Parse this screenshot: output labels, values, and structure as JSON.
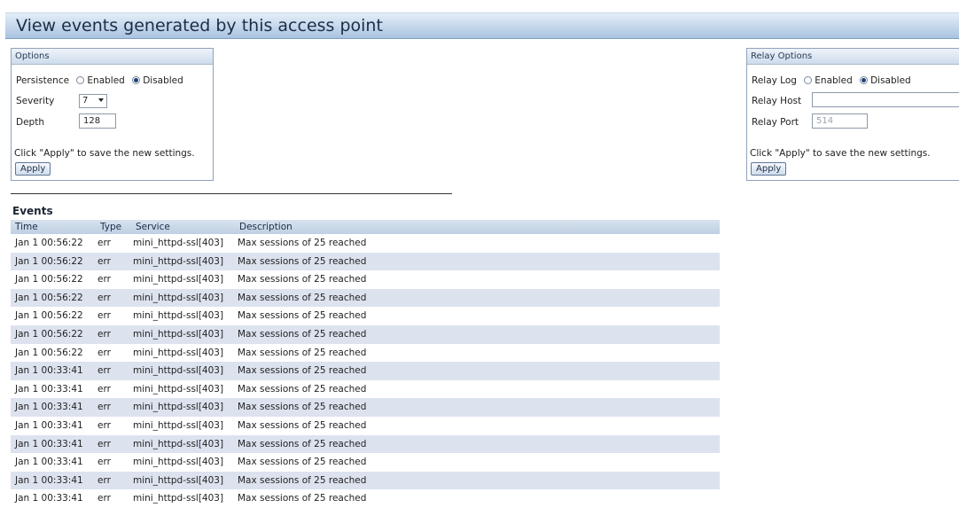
{
  "page": {
    "title": "View events generated by this access point"
  },
  "options": {
    "heading": "Options",
    "persistence_label": "Persistence",
    "persistence_enabled": "Enabled",
    "persistence_disabled": "Disabled",
    "persistence_value": "Disabled",
    "severity_label": "Severity",
    "severity_value": "7",
    "depth_label": "Depth",
    "depth_value": "128",
    "apply_note": "Click \"Apply\" to save the new settings.",
    "apply_label": "Apply"
  },
  "relay": {
    "heading": "Relay Options",
    "log_label": "Relay Log",
    "log_enabled": "Enabled",
    "log_disabled": "Disabled",
    "log_value": "Disabled",
    "host_label": "Relay Host",
    "host_value": "",
    "port_label": "Relay Port",
    "port_value": "514",
    "apply_note": "Click \"Apply\" to save the new settings.",
    "apply_label": "Apply"
  },
  "events": {
    "heading": "Events",
    "columns": [
      "Time",
      "Type",
      "Service",
      "Description"
    ],
    "rows": [
      {
        "time": "Jan 1 00:56:22",
        "type": "err",
        "service": "mini_httpd-ssl[403]",
        "description": "Max sessions of 25 reached"
      },
      {
        "time": "Jan 1 00:56:22",
        "type": "err",
        "service": "mini_httpd-ssl[403]",
        "description": "Max sessions of 25 reached"
      },
      {
        "time": "Jan 1 00:56:22",
        "type": "err",
        "service": "mini_httpd-ssl[403]",
        "description": "Max sessions of 25 reached"
      },
      {
        "time": "Jan 1 00:56:22",
        "type": "err",
        "service": "mini_httpd-ssl[403]",
        "description": "Max sessions of 25 reached"
      },
      {
        "time": "Jan 1 00:56:22",
        "type": "err",
        "service": "mini_httpd-ssl[403]",
        "description": "Max sessions of 25 reached"
      },
      {
        "time": "Jan 1 00:56:22",
        "type": "err",
        "service": "mini_httpd-ssl[403]",
        "description": "Max sessions of 25 reached"
      },
      {
        "time": "Jan 1 00:56:22",
        "type": "err",
        "service": "mini_httpd-ssl[403]",
        "description": "Max sessions of 25 reached"
      },
      {
        "time": "Jan 1 00:33:41",
        "type": "err",
        "service": "mini_httpd-ssl[403]",
        "description": "Max sessions of 25 reached"
      },
      {
        "time": "Jan 1 00:33:41",
        "type": "err",
        "service": "mini_httpd-ssl[403]",
        "description": "Max sessions of 25 reached"
      },
      {
        "time": "Jan 1 00:33:41",
        "type": "err",
        "service": "mini_httpd-ssl[403]",
        "description": "Max sessions of 25 reached"
      },
      {
        "time": "Jan 1 00:33:41",
        "type": "err",
        "service": "mini_httpd-ssl[403]",
        "description": "Max sessions of 25 reached"
      },
      {
        "time": "Jan 1 00:33:41",
        "type": "err",
        "service": "mini_httpd-ssl[403]",
        "description": "Max sessions of 25 reached"
      },
      {
        "time": "Jan 1 00:33:41",
        "type": "err",
        "service": "mini_httpd-ssl[403]",
        "description": "Max sessions of 25 reached"
      },
      {
        "time": "Jan 1 00:33:41",
        "type": "err",
        "service": "mini_httpd-ssl[403]",
        "description": "Max sessions of 25 reached"
      },
      {
        "time": "Jan 1 00:33:41",
        "type": "err",
        "service": "mini_httpd-ssl[403]",
        "description": "Max sessions of 25 reached"
      }
    ]
  }
}
